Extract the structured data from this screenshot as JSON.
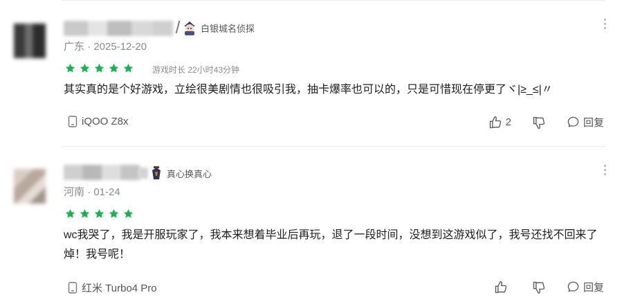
{
  "reviews": [
    {
      "badge": "白银城名侦探",
      "location_date": "广东 · 2025-12-20",
      "rating": 5,
      "playtime": "游戏时长 22小时43分钟",
      "content": "其实真的是个好游戏，立绘很美剧情也很吸引我，抽卡爆率也可以的，只是可惜现在停更了ヾ|≥_≤|〃",
      "device": "iQOO Z8x",
      "likes": "2",
      "reply_label": "回复"
    },
    {
      "badge": "真心换真心",
      "location_date": "河南 · 01-24",
      "rating": 5,
      "playtime": "",
      "content": "wc我哭了，我是开服玩家了，我本来想着毕业后再玩，退了一段时间，没想到这游戏似了，我号还找不回来了焯！我号呢！",
      "device": "红米 Turbo4 Pro",
      "likes": "",
      "reply_label": "回复"
    }
  ],
  "colors": {
    "star": "#19b44f",
    "divider": "#ececec"
  },
  "icons": [
    "device-icon",
    "thumb-up-icon",
    "thumb-down-icon",
    "comment-icon",
    "more-icon",
    "badge-icon"
  ]
}
